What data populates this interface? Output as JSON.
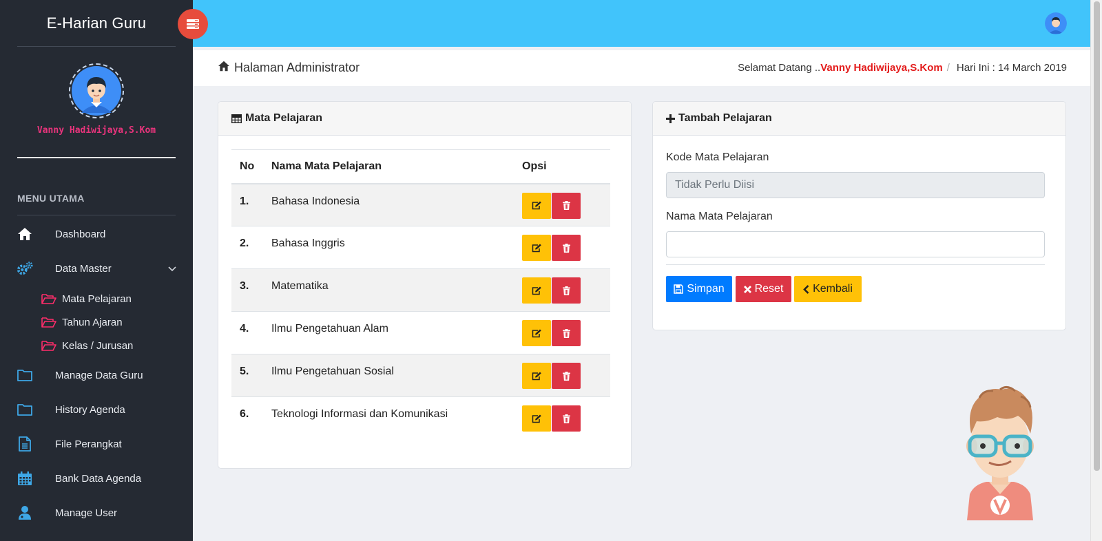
{
  "app": {
    "title": "E-Harian Guru"
  },
  "user": {
    "name": "Vanny Hadiwijaya,S.Kom"
  },
  "sidebar": {
    "menu_heading": "MENU UTAMA",
    "items": [
      {
        "label": "Dashboard",
        "icon": "home-icon"
      },
      {
        "label": "Data Master",
        "icon": "gears-icon"
      },
      {
        "label": "Manage Data Guru",
        "icon": "folder-icon"
      },
      {
        "label": "History Agenda",
        "icon": "folder-icon"
      },
      {
        "label": "File Perangkat",
        "icon": "file-icon"
      },
      {
        "label": "Bank Data Agenda",
        "icon": "calendar-icon"
      },
      {
        "label": "Manage User",
        "icon": "user-icon"
      }
    ],
    "sub_items": [
      {
        "label": "Mata Pelajaran",
        "icon": "folder-open-icon"
      },
      {
        "label": "Tahun Ajaran",
        "icon": "folder-open-icon"
      },
      {
        "label": "Kelas / Jurusan",
        "icon": "folder-open-icon"
      }
    ]
  },
  "header": {
    "title": "Halaman Administrator",
    "welcome_prefix": "Selamat Datang ..",
    "welcome_name": "Vanny Hadiwijaya,S.Kom",
    "separator": "/",
    "date_text": "Hari Ini : 14 March 2019"
  },
  "subjects_card": {
    "title": "Mata Pelajaran",
    "columns": [
      "No",
      "Nama Mata Pelajaran",
      "Opsi"
    ],
    "rows": [
      {
        "no": "1.",
        "name": "Bahasa Indonesia"
      },
      {
        "no": "2.",
        "name": "Bahasa Inggris"
      },
      {
        "no": "3.",
        "name": "Matematika"
      },
      {
        "no": "4.",
        "name": "Ilmu Pengetahuan Alam"
      },
      {
        "no": "5.",
        "name": "Ilmu Pengetahuan Sosial"
      },
      {
        "no": "6.",
        "name": "Teknologi Informasi dan Komunikasi"
      }
    ]
  },
  "form_card": {
    "title": "Tambah Pelajaran",
    "kode_label": "Kode Mata Pelajaran",
    "kode_placeholder": "Tidak Perlu Diisi",
    "nama_label": "Nama Mata Pelajaran",
    "nama_value": "",
    "save_label": "Simpan",
    "reset_label": "Reset",
    "back_label": "Kembali"
  },
  "colors": {
    "sidebar_bg": "#252a33",
    "topbar_bg": "#41c4fb",
    "accent_pink": "#e8347c",
    "warning": "#ffc107",
    "danger": "#dc3545",
    "primary": "#007bff"
  }
}
